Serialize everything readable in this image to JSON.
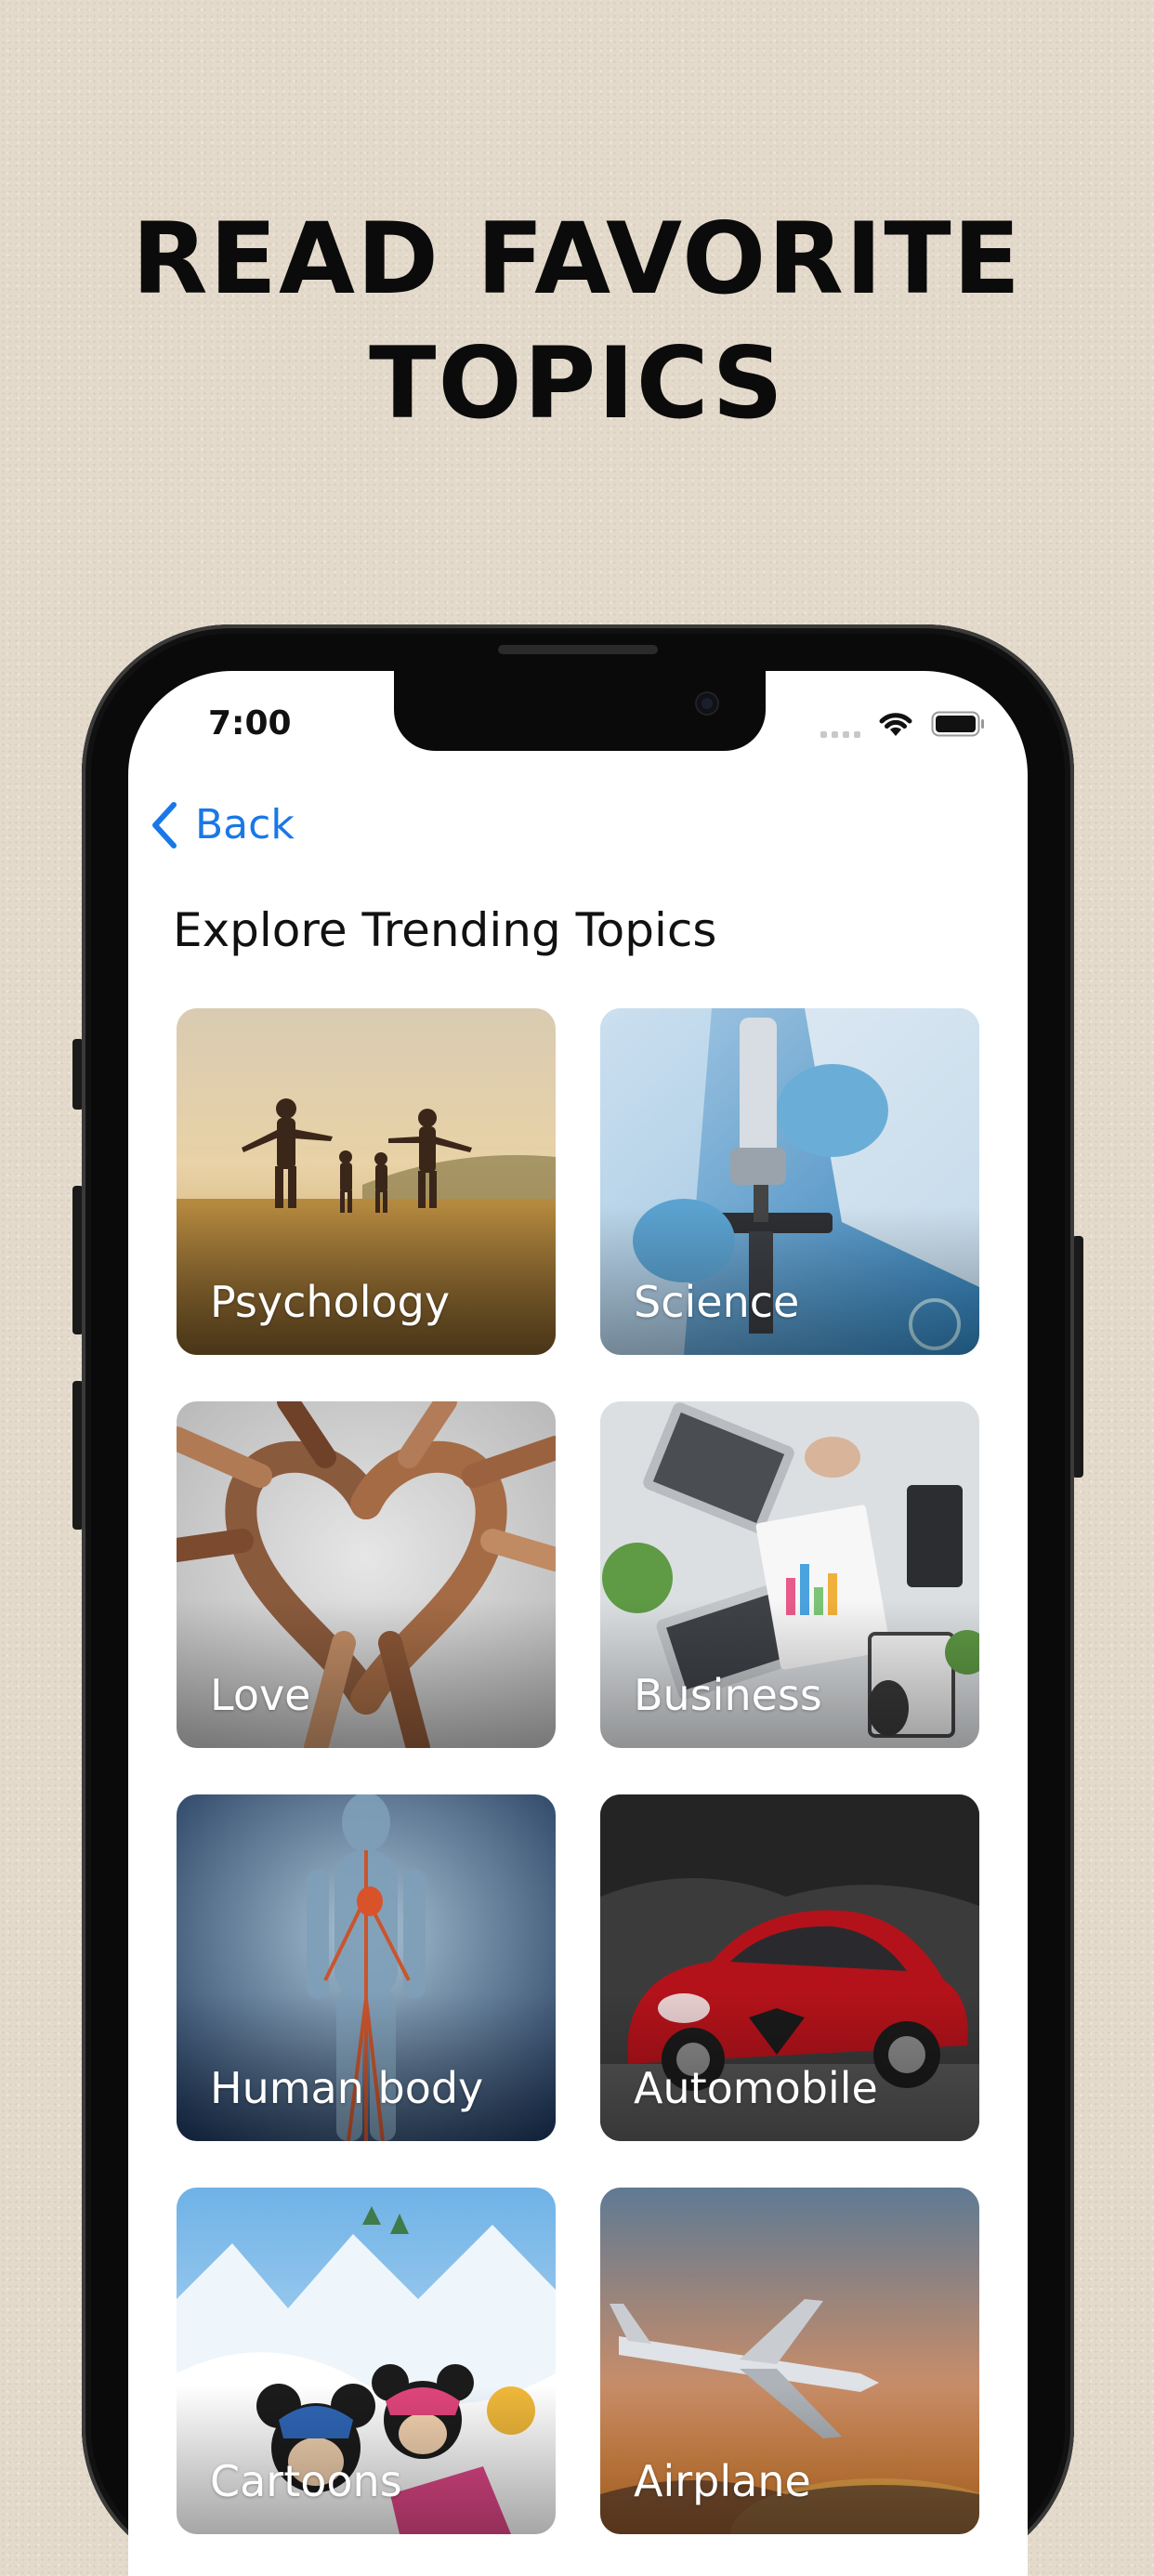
{
  "headline": {
    "line1": "READ FAVORITE",
    "line2": "TOPICS"
  },
  "status_bar": {
    "time": "7:00"
  },
  "nav": {
    "back_label": "Back"
  },
  "page": {
    "title": "Explore Trending Topics"
  },
  "topics": [
    {
      "label": "Psychology"
    },
    {
      "label": "Science"
    },
    {
      "label": "Love"
    },
    {
      "label": "Business"
    },
    {
      "label": "Human body"
    },
    {
      "label": "Automobile"
    },
    {
      "label": "Cartoons"
    },
    {
      "label": "Airplane"
    }
  ],
  "colors": {
    "accent": "#1a78e6",
    "background": "#e4dacb",
    "phone_frame": "#0a0a0a"
  },
  "icons": [
    "chevron-left-icon",
    "wifi-icon",
    "battery-icon",
    "cellular-signal-icon"
  ]
}
